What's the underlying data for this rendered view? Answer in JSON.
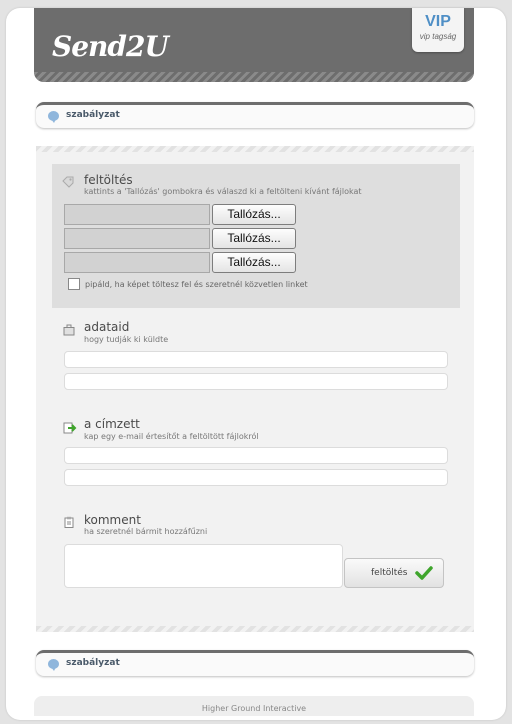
{
  "header": {
    "logo_text": "Send2U",
    "vip_title": "VIP",
    "vip_subtitle": "vip tagság"
  },
  "policy_top": {
    "label": "szabályzat"
  },
  "upload": {
    "title": "feltöltés",
    "subtitle": "kattints a 'Tallózás' gombokra és válaszd ki a feltölteni kívánt fájlokat",
    "files": [
      {
        "value": "",
        "browse_label": "Tallózás..."
      },
      {
        "value": "",
        "browse_label": "Tallózás..."
      },
      {
        "value": "",
        "browse_label": "Tallózás..."
      }
    ],
    "direct_link_label": "pipáld, ha képet töltesz fel és szeretnél közvetlen linket"
  },
  "sender": {
    "title": "adataid",
    "subtitle": "hogy tudják ki küldte",
    "name_value": "",
    "email_value": ""
  },
  "recipient": {
    "title": "a címzett",
    "subtitle": "kap egy e-mail értesítőt a feltöltött fájlokról",
    "field1_value": "",
    "field2_value": ""
  },
  "comment": {
    "title": "komment",
    "subtitle": "ha szeretnél bármit hozzáfűzni",
    "value": "",
    "submit_label": "feltöltés"
  },
  "policy_bottom": {
    "label": "szabályzat"
  },
  "footer": {
    "text": "Higher Ground Interactive"
  },
  "colors": {
    "header_bg": "#6d6d6d",
    "vip_accent": "#4f8fc6",
    "check_green": "#3fa52c",
    "panel_bg": "#f2f2f2",
    "upload_box_bg": "#dedede"
  }
}
